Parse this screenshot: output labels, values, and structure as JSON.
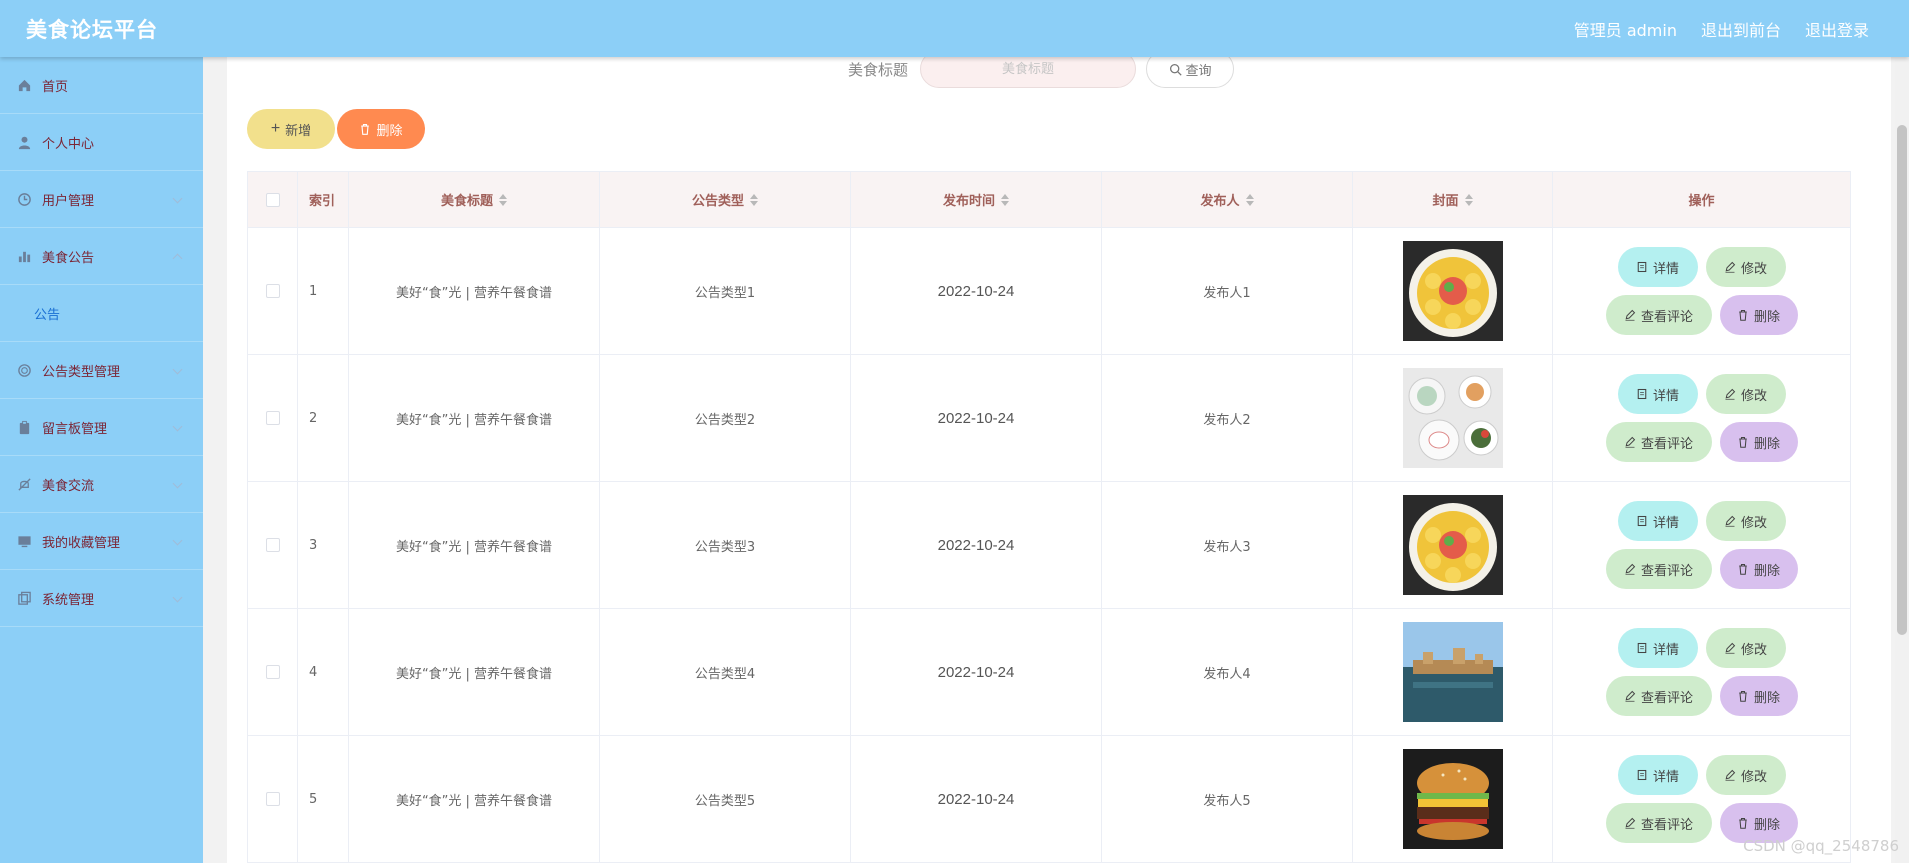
{
  "header": {
    "brand": "美食论坛平台",
    "links": [
      "管理员 admin",
      "退出到前台",
      "退出登录"
    ]
  },
  "sidebar": {
    "items": [
      {
        "label": "首页",
        "icon": "home-icon"
      },
      {
        "label": "个人中心",
        "icon": "user-icon"
      },
      {
        "label": "用户管理",
        "icon": "clock-icon"
      },
      {
        "label": "美食公告",
        "icon": "bar-chart-icon"
      },
      {
        "label": "公告",
        "sub": true
      },
      {
        "label": "公告类型管理",
        "icon": "globe-icon"
      },
      {
        "label": "留言板管理",
        "icon": "clipboard-icon"
      },
      {
        "label": "美食交流",
        "icon": "no-bell-icon"
      },
      {
        "label": "我的收藏管理",
        "icon": "monitor-icon"
      },
      {
        "label": "系统管理",
        "icon": "copy-icon"
      }
    ]
  },
  "search": {
    "label": "美食标题",
    "placeholder": "美食标题",
    "button_label": "查询"
  },
  "toolbar": {
    "add_label": "新增",
    "delete_label": "删除"
  },
  "table": {
    "headers": {
      "index": "索引",
      "title": "美食标题",
      "type": "公告类型",
      "time": "发布时间",
      "publisher": "发布人",
      "cover": "封面",
      "ops": "操作"
    },
    "rows": [
      {
        "index": "1",
        "title": "美好“食”光 | 营养午餐食谱",
        "type": "公告类型1",
        "time": "2022-10-24",
        "publisher": "发布人1",
        "cover": "food-dish"
      },
      {
        "index": "2",
        "title": "美好“食”光 | 营养午餐食谱",
        "type": "公告类型2",
        "time": "2022-10-24",
        "publisher": "发布人2",
        "cover": "breakfast-table"
      },
      {
        "index": "3",
        "title": "美好“食”光 | 营养午餐食谱",
        "type": "公告类型3",
        "time": "2022-10-24",
        "publisher": "发布人3",
        "cover": "food-dish"
      },
      {
        "index": "4",
        "title": "美好“食”光 | 营养午餐食谱",
        "type": "公告类型4",
        "time": "2022-10-24",
        "publisher": "发布人4",
        "cover": "town-lake"
      },
      {
        "index": "5",
        "title": "美好“食”光 | 营养午餐食谱",
        "type": "公告类型5",
        "time": "2022-10-24",
        "publisher": "发布人5",
        "cover": "burger"
      }
    ],
    "op_labels": {
      "detail": "详情",
      "edit": "修改",
      "comment": "查看评论",
      "delete": "删除"
    }
  },
  "watermark": "CSDN @qq_2548786",
  "colors": {
    "topbar": "#8ccff7",
    "sidebar": "#8ccff7",
    "add_button": "#f2e08c",
    "delete_button": "#ff8a50",
    "detail_button": "#b4f0f0",
    "edit_button": "#cfeccc",
    "row_delete_button": "#d8c0ee"
  }
}
